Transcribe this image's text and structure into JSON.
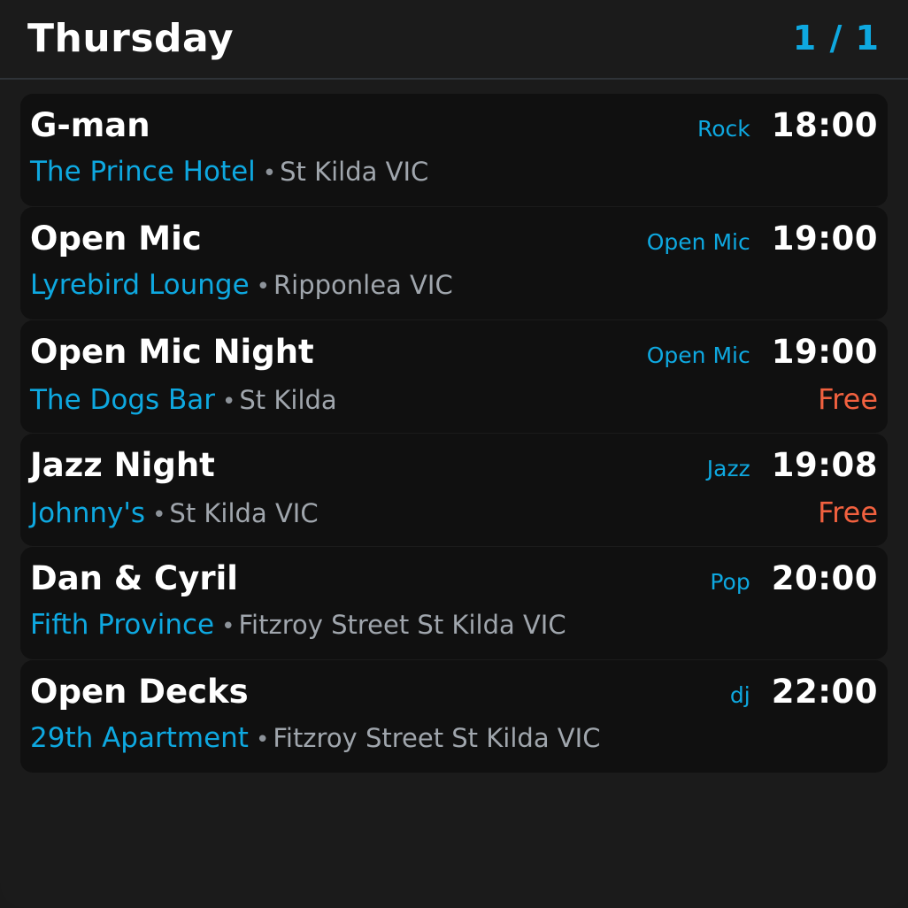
{
  "header": {
    "day": "Thursday",
    "page_indicator": "1 / 1"
  },
  "separator": "•",
  "events": [
    {
      "name": "G-man",
      "genre": "Rock",
      "time": "18:00",
      "venue": "The Prince Hotel",
      "location": "St Kilda VIC",
      "price": ""
    },
    {
      "name": "Open Mic",
      "genre": "Open Mic",
      "time": "19:00",
      "venue": "Lyrebird Lounge",
      "location": "Ripponlea VIC",
      "price": ""
    },
    {
      "name": "Open Mic Night",
      "genre": "Open Mic",
      "time": "19:00",
      "venue": "The Dogs Bar",
      "location": "St Kilda",
      "price": "Free"
    },
    {
      "name": "Jazz Night",
      "genre": "Jazz",
      "time": "19:08",
      "venue": "Johnny's",
      "location": "St Kilda VIC",
      "price": "Free"
    },
    {
      "name": "Dan & Cyril",
      "genre": "Pop",
      "time": "20:00",
      "venue": "Fifth Province",
      "location": "Fitzroy Street St Kilda VIC",
      "price": ""
    },
    {
      "name": "Open Decks",
      "genre": "dj",
      "time": "22:00",
      "venue": "29th Apartment",
      "location": "Fitzroy Street St Kilda VIC",
      "price": ""
    }
  ],
  "colors": {
    "accent": "#0ea8e0",
    "price": "#f2613f",
    "card_background": "#101010",
    "page_background": "#1b1b1b"
  }
}
